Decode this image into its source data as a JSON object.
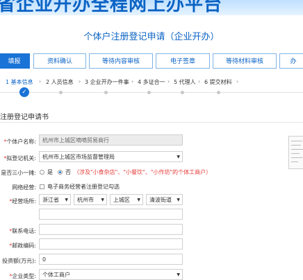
{
  "banner": {
    "text": "省企业开办全程网上办平台"
  },
  "app_title": "个体户注册登记申请（企业开办）",
  "steps": [
    "填报",
    "资料确认",
    "等待内容审核",
    "电子签章",
    "等待材料审核",
    "办"
  ],
  "substeps": [
    {
      "number": "1",
      "label": "基本信息"
    },
    {
      "number": "2",
      "label": "人员信息"
    },
    {
      "number": "3",
      "label": "企业开办一件事"
    },
    {
      "number": "4",
      "label": "多证合一"
    },
    {
      "number": "5",
      "label": "代理人"
    },
    {
      "number": "6",
      "label": "提交材料"
    }
  ],
  "section_title": "注册登记申请书",
  "form": {
    "name": {
      "label": "个体户名称:",
      "value": "杭州市上城区嘀嘀贸易商行"
    },
    "authority": {
      "label": "拟登记机关:",
      "value": "杭州市上城区市场监督管理局"
    },
    "sanxiaoyi": {
      "label": "是否三小一摊:",
      "yes": "是",
      "no": "否",
      "hint": "（涉及\"小食杂店\"、\"小餐饮\"、\"小作坊\"的个体工商户）"
    },
    "online": {
      "label": "网络经营:",
      "option": "电子商务经营者注册登记勾选"
    },
    "location": {
      "label": "经营场所:",
      "province": "浙江省",
      "city": "杭州市",
      "district": "上城区",
      "street": "清波街道"
    },
    "phone": {
      "label": "联系电话:",
      "value": ""
    },
    "postcode": {
      "label": "邮政编码:",
      "value": ""
    },
    "capital": {
      "label": "投资额(万元):",
      "value": "0"
    },
    "type": {
      "label": "企业类型:",
      "value": "个体工商户"
    }
  }
}
